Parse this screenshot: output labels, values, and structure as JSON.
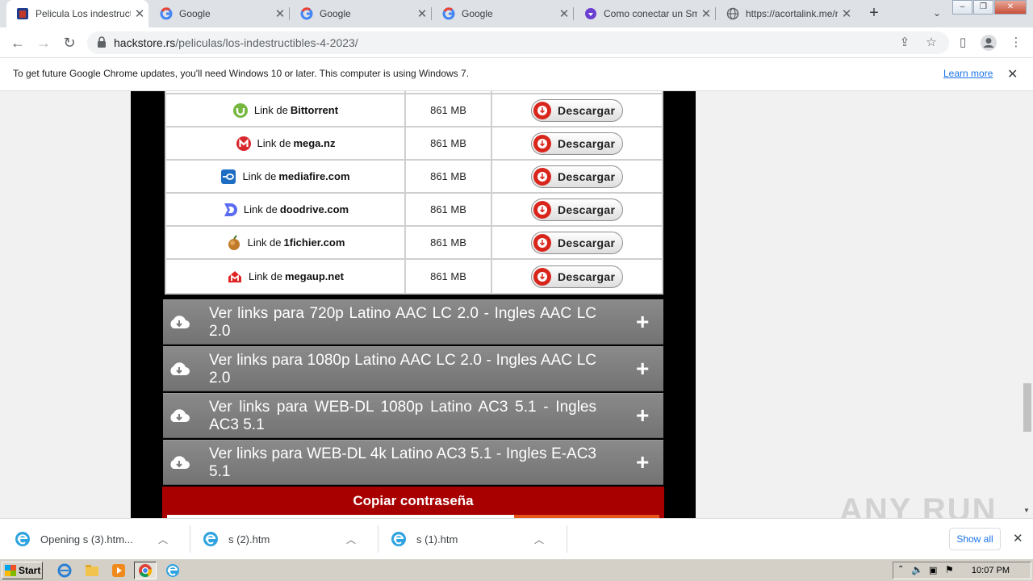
{
  "browser": {
    "tabs": [
      {
        "title": "Pelicula Los indestructibles",
        "active": true,
        "icon": "site-favicon"
      },
      {
        "title": "Google",
        "icon": "google-icon"
      },
      {
        "title": "Google",
        "icon": "google-icon"
      },
      {
        "title": "Google",
        "icon": "google-icon"
      },
      {
        "title": "Como conectar un Smart",
        "icon": "shield-icon"
      },
      {
        "title": "https://acortalink.me/n",
        "icon": "globe-icon"
      }
    ],
    "new_tab": "+",
    "url_host": "hackstore.rs",
    "url_path": "/peliculas/los-indestructibles-4-2023/"
  },
  "infobar": {
    "message": "To get future Google Chrome updates, you'll need Windows 10 or later. This computer is using Windows 7.",
    "link": "Learn more"
  },
  "download_table": {
    "rows": [
      {
        "prefix": "Link de",
        "service": "Bittorrent",
        "icon": "bittorrent-icon",
        "size": "861 MB",
        "button": "Descargar"
      },
      {
        "prefix": "Link de",
        "service": "mega.nz",
        "icon": "mega-icon",
        "size": "861 MB",
        "button": "Descargar"
      },
      {
        "prefix": "Link de",
        "service": "mediafire.com",
        "icon": "mediafire-icon",
        "size": "861 MB",
        "button": "Descargar"
      },
      {
        "prefix": "Link de",
        "service": "doodrive.com",
        "icon": "doodrive-icon",
        "size": "861 MB",
        "button": "Descargar"
      },
      {
        "prefix": "Link de",
        "service": "1fichier.com",
        "icon": "1fichier-icon",
        "size": "861 MB",
        "button": "Descargar"
      },
      {
        "prefix": "Link de",
        "service": "megaup.net",
        "icon": "megaup-icon",
        "size": "861 MB",
        "button": "Descargar"
      }
    ]
  },
  "accordions": [
    {
      "title": "Ver links para 720p Latino AAC LC 2.0 - Ingles AAC LC 2.0"
    },
    {
      "title": "Ver links para 1080p Latino AAC LC 2.0 - Ingles AAC LC 2.0"
    },
    {
      "title": "Ver links para WEB-DL 1080p Latino AC3 5.1 - Ingles AC3 5.1"
    },
    {
      "title": "Ver links para WEB-DL 4k Latino AC3 5.1 - Ingles E-AC3 5.1"
    }
  ],
  "copy_password": "Copiar contraseña",
  "downloads": {
    "items": [
      {
        "name": "Opening s (3).htm..."
      },
      {
        "name": "s (2).htm"
      },
      {
        "name": "s (1).htm"
      }
    ],
    "show_all": "Show all"
  },
  "watermark": "ANY RUN",
  "taskbar": {
    "start": "Start",
    "clock": "10:07 PM"
  },
  "colors": {
    "accent_red": "#a80000",
    "accordion_grey": "#808080",
    "link_blue": "#1a73e8"
  }
}
